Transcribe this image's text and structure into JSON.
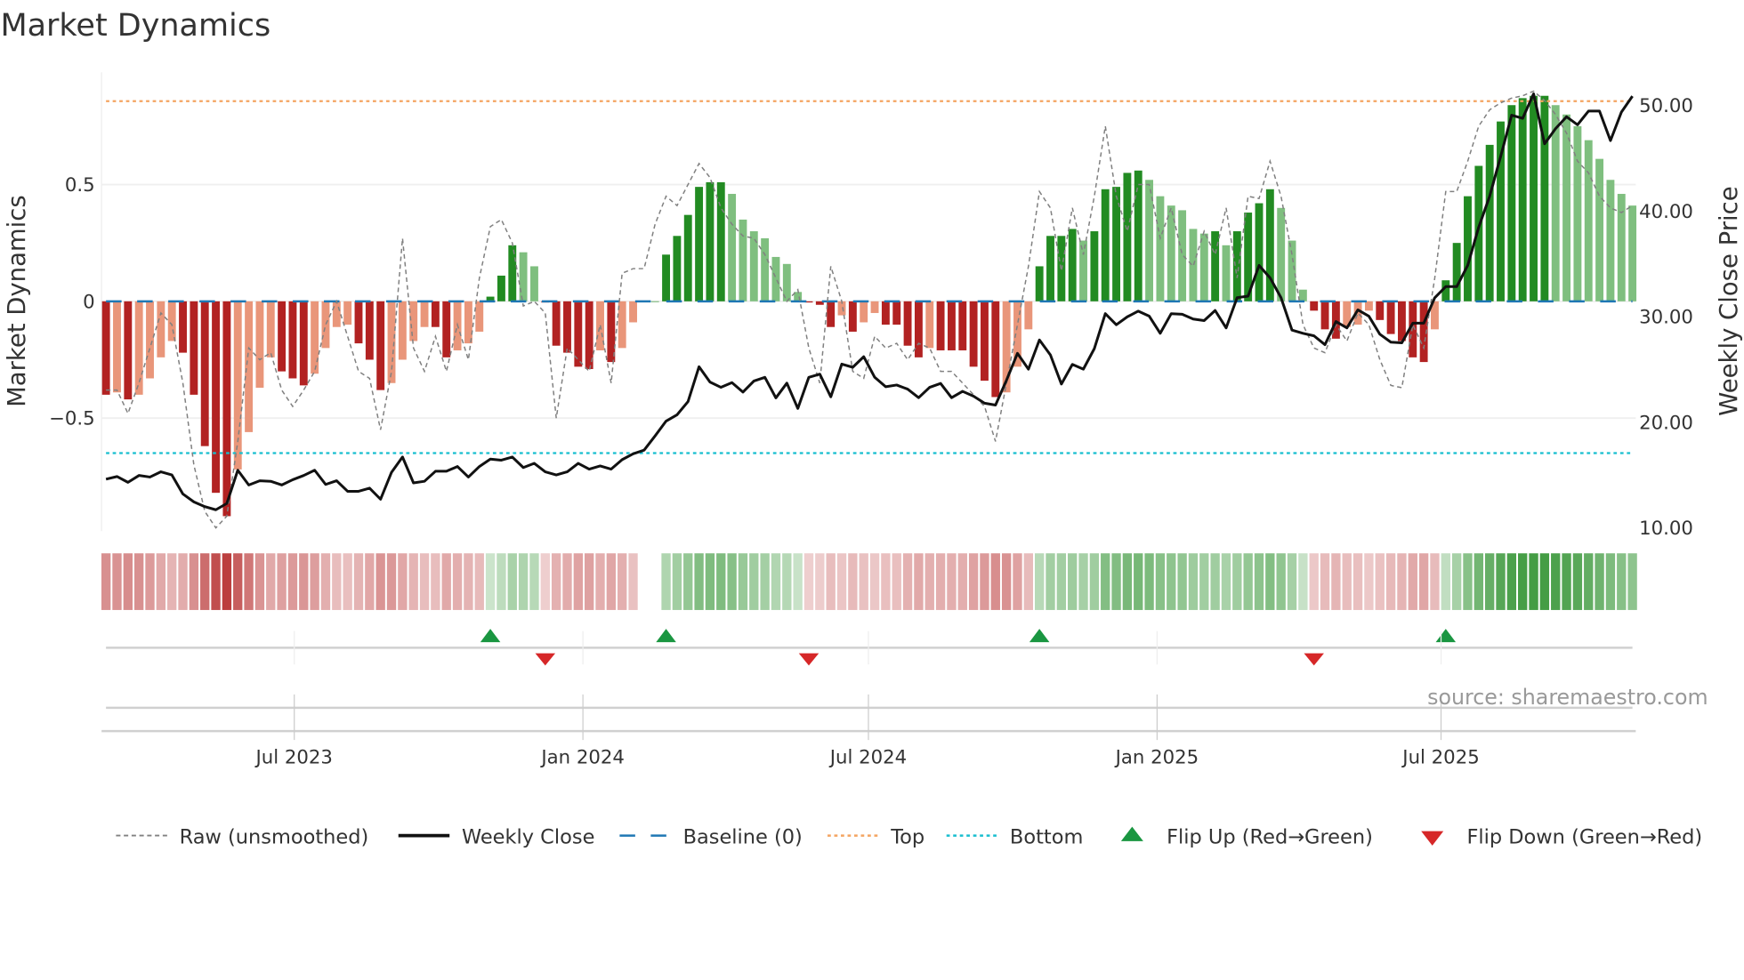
{
  "chart_data": {
    "type": "bar",
    "title": "Market Dynamics",
    "ylabel": "Market Dynamics",
    "y2label": "Weekly Close Price",
    "source": "source: sharemaestro.com",
    "start_date": "2023-03-03",
    "frequency": "weekly",
    "ylim": [
      -0.984,
      0.981
    ],
    "y2lim": [
      9.58,
      53.05
    ],
    "yticks": [
      {
        "v": 0.5,
        "label": "0.5"
      },
      {
        "v": 0,
        "label": "0"
      },
      {
        "v": -0.5,
        "label": "−0.5"
      }
    ],
    "y2ticks": [
      {
        "v": 50,
        "label": "50.00"
      },
      {
        "v": 40,
        "label": "40.00"
      },
      {
        "v": 30,
        "label": "30.00"
      },
      {
        "v": 20,
        "label": "20.00"
      },
      {
        "v": 10,
        "label": "10.00"
      }
    ],
    "xticks": [
      {
        "date": "2023-07-01",
        "label": "Jul 2023"
      },
      {
        "date": "2024-01-01",
        "label": "Jan 2024"
      },
      {
        "date": "2024-07-01",
        "label": "Jul 2024"
      },
      {
        "date": "2025-01-01",
        "label": "Jan 2025"
      },
      {
        "date": "2025-07-01",
        "label": "Jul 2025"
      }
    ],
    "top_level": 0.857,
    "bottom_level": -0.65,
    "baseline": 0,
    "grid": true,
    "legend_position": "bottom",
    "colors": {
      "neg_strong": "#b22222",
      "neg_weak": "#e9967a",
      "pos_strong": "#228b22",
      "pos_weak": "#7fbf7f",
      "raw": "#808080",
      "close": "#111111",
      "baseline": "#1f77b4",
      "top": "#f4a460",
      "bottom": "#17becf",
      "flip_up": "#1a9641",
      "flip_down": "#d62728"
    },
    "series": [
      {
        "name": "Market Dynamics (smoothed)",
        "values": [
          -0.4,
          -0.39,
          -0.42,
          -0.4,
          -0.33,
          -0.24,
          -0.17,
          -0.22,
          -0.4,
          -0.62,
          -0.82,
          -0.92,
          -0.72,
          -0.56,
          -0.37,
          -0.24,
          -0.3,
          -0.33,
          -0.36,
          -0.31,
          -0.2,
          -0.11,
          -0.1,
          -0.18,
          -0.25,
          -0.38,
          -0.35,
          -0.25,
          -0.17,
          -0.11,
          -0.11,
          -0.24,
          -0.21,
          -0.18,
          -0.13,
          0.02,
          0.11,
          0.24,
          0.21,
          0.15,
          -0.005,
          -0.19,
          -0.22,
          -0.28,
          -0.29,
          -0.21,
          -0.26,
          -0.2,
          -0.09,
          -0.002,
          0.0,
          0.2,
          0.28,
          0.37,
          0.49,
          0.51,
          0.51,
          0.46,
          0.35,
          0.3,
          0.27,
          0.19,
          0.16,
          0.04,
          -0.005,
          -0.015,
          -0.11,
          -0.06,
          -0.13,
          -0.09,
          -0.05,
          -0.1,
          -0.1,
          -0.19,
          -0.24,
          -0.2,
          -0.21,
          -0.21,
          -0.21,
          -0.28,
          -0.34,
          -0.41,
          -0.39,
          -0.28,
          -0.12,
          0.15,
          0.28,
          0.28,
          0.31,
          0.26,
          0.3,
          0.48,
          0.49,
          0.55,
          0.56,
          0.52,
          0.45,
          0.41,
          0.39,
          0.31,
          0.29,
          0.3,
          0.24,
          0.3,
          0.38,
          0.42,
          0.48,
          0.4,
          0.26,
          0.05,
          -0.04,
          -0.12,
          -0.16,
          -0.11,
          -0.1,
          -0.04,
          -0.08,
          -0.14,
          -0.17,
          -0.24,
          -0.26,
          -0.12,
          0.09,
          0.25,
          0.45,
          0.58,
          0.67,
          0.77,
          0.84,
          0.87,
          0.88,
          0.88,
          0.84,
          0.8,
          0.75,
          0.69,
          0.61,
          0.52,
          0.46,
          0.41
        ]
      },
      {
        "name": "Raw (unsmoothed)",
        "values": [
          -0.38,
          -0.38,
          -0.48,
          -0.35,
          -0.2,
          -0.05,
          -0.1,
          -0.35,
          -0.7,
          -0.9,
          -0.97,
          -0.92,
          -0.6,
          -0.2,
          -0.25,
          -0.22,
          -0.38,
          -0.45,
          -0.38,
          -0.3,
          -0.1,
          0.0,
          -0.15,
          -0.3,
          -0.33,
          -0.55,
          -0.3,
          0.27,
          -0.2,
          -0.3,
          -0.15,
          -0.3,
          -0.1,
          -0.25,
          0.1,
          0.32,
          0.35,
          0.25,
          -0.02,
          0.0,
          -0.05,
          -0.5,
          -0.2,
          -0.25,
          -0.3,
          -0.1,
          -0.35,
          0.12,
          0.14,
          0.14,
          0.33,
          0.45,
          0.41,
          0.5,
          0.59,
          0.53,
          0.4,
          0.33,
          0.28,
          0.27,
          0.2,
          0.1,
          0.0,
          0.05,
          -0.2,
          -0.35,
          0.15,
          0.0,
          -0.3,
          -0.33,
          -0.15,
          -0.2,
          -0.18,
          -0.25,
          -0.18,
          -0.2,
          -0.3,
          -0.3,
          -0.35,
          -0.4,
          -0.45,
          -0.6,
          -0.35,
          -0.1,
          0.15,
          0.47,
          0.4,
          0.13,
          0.4,
          0.2,
          0.45,
          0.75,
          0.45,
          0.3,
          0.5,
          0.5,
          0.27,
          0.4,
          0.2,
          0.15,
          0.3,
          0.2,
          0.4,
          0.1,
          0.45,
          0.44,
          0.6,
          0.45,
          0.2,
          -0.1,
          -0.2,
          -0.22,
          -0.1,
          -0.17,
          -0.05,
          -0.1,
          -0.25,
          -0.36,
          -0.37,
          -0.1,
          -0.2,
          0.1,
          0.47,
          0.47,
          0.6,
          0.75,
          0.82,
          0.85,
          0.87,
          0.88,
          0.9,
          0.86,
          0.8,
          0.72,
          0.6,
          0.55,
          0.45,
          0.4,
          0.38,
          0.41
        ]
      },
      {
        "name": "Weekly Close",
        "axis": "right",
        "values": [
          14.5,
          14.75,
          14.2,
          14.85,
          14.7,
          15.2,
          14.9,
          13.1,
          12.35,
          11.9,
          11.6,
          12.2,
          15.35,
          13.95,
          14.35,
          14.3,
          13.95,
          14.45,
          14.85,
          15.35,
          14.0,
          14.35,
          13.35,
          13.35,
          13.65,
          12.6,
          15.15,
          16.6,
          14.15,
          14.3,
          15.25,
          15.25,
          15.7,
          14.7,
          15.7,
          16.4,
          16.3,
          16.6,
          15.6,
          16.0,
          15.2,
          14.9,
          15.2,
          16.0,
          15.45,
          15.75,
          15.45,
          16.35,
          16.9,
          17.25,
          18.6,
          20.0,
          20.6,
          21.85,
          25.15,
          23.7,
          23.2,
          23.65,
          22.75,
          23.8,
          24.15,
          22.2,
          23.6,
          21.2,
          24.15,
          24.45,
          22.3,
          25.4,
          25.1,
          26.1,
          24.15,
          23.26,
          23.42,
          23.03,
          22.22,
          23.2,
          23.57,
          22.22,
          22.82,
          22.36,
          21.7,
          21.52,
          23.87,
          26.42,
          24.92,
          27.69,
          26.27,
          23.51,
          25.37,
          24.92,
          26.87,
          30.18,
          29.13,
          29.88,
          30.42,
          29.94,
          28.32,
          30.18,
          30.12,
          29.67,
          29.52,
          30.48,
          28.83,
          31.69,
          31.84,
          34.75,
          33.58,
          31.69,
          28.62,
          28.32,
          28.08,
          27.24,
          29.43,
          28.83,
          30.54,
          29.94,
          28.23,
          27.48,
          27.42,
          29.28,
          29.28,
          31.69,
          32.74,
          32.74,
          34.75,
          38.36,
          41.31,
          45.07,
          48.98,
          48.68,
          51.0,
          46.27,
          47.71,
          48.83,
          48.07,
          49.37,
          49.37,
          46.57,
          49.28,
          50.78
        ]
      }
    ],
    "flips": [
      {
        "week": 35,
        "dir": "up"
      },
      {
        "week": 40,
        "dir": "down"
      },
      {
        "week": 51,
        "dir": "up"
      },
      {
        "week": 64,
        "dir": "down"
      },
      {
        "week": 85,
        "dir": "up"
      },
      {
        "week": 110,
        "dir": "down"
      },
      {
        "week": 122,
        "dir": "up"
      }
    ],
    "legend": [
      {
        "label": "Raw (unsmoothed)",
        "kind": "raw"
      },
      {
        "label": "Weekly Close",
        "kind": "close"
      },
      {
        "label": "Baseline (0)",
        "kind": "baseline"
      },
      {
        "label": "Top",
        "kind": "top"
      },
      {
        "label": "Bottom",
        "kind": "bottom"
      },
      {
        "label": "Flip Up (Red→Green)",
        "kind": "flip_up"
      },
      {
        "label": "Flip Down (Green→Red)",
        "kind": "flip_down"
      }
    ]
  }
}
